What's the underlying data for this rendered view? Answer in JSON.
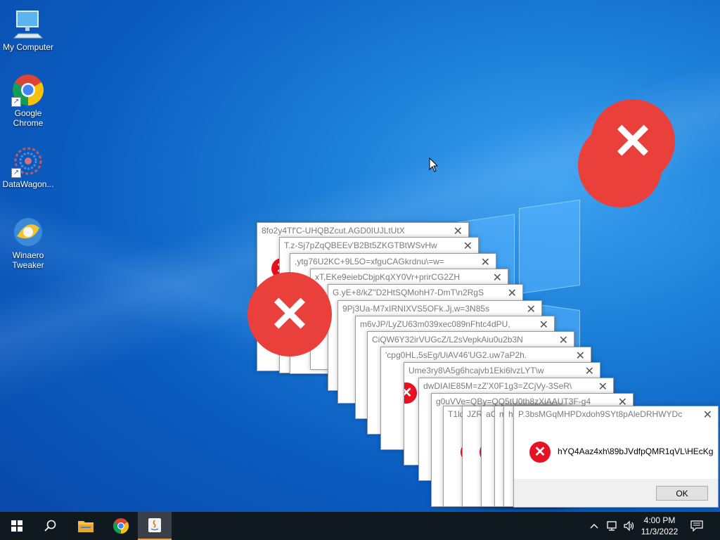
{
  "desktop": {
    "icons": [
      {
        "label": "My Computer",
        "icon": "computer-icon"
      },
      {
        "label": "Google Chrome",
        "icon": "chrome-icon"
      },
      {
        "label": "DataWagon...",
        "icon": "datawagon-icon"
      },
      {
        "label": "Winaero Tweaker",
        "icon": "winaero-icon"
      }
    ]
  },
  "dialogs": {
    "titles": [
      "8fo2y4Tf'C-UHQBZcut.AGD0IUJLtUtX",
      "T.z-Sj7pZqQBEEv'B2Bt5ZKGTBtWSvHw",
      ",ytg76U2KC+9L5O=xfguCAGkrdnu\\=w=",
      "xT,EKe9eiebCbjpKqXY0Vr+prirCG2ZH",
      "G.yE+8/kZ''D2HtSQMohH7-DmT\\n2RgS",
      "9Pj3Ua-M7xIRNIXVS5OFk.Jj,w=3N85s",
      "m6vJP/LyZU63m039xec089nFhtc4dPU,",
      "CiQW6Y32irVUGcZ/L2sVepkAiu0u2b3N",
      "'cpg0HL,5sEg/UiAV46'UG2.uw7aP2h.",
      "Ume3ry8\\A5g6hcajvb1Eki6lvzLYT\\w",
      "dwDIAIE85M=zZ'X0F1g3=ZCjVy-3SeR\\",
      "g0uVVe=QBy=QQ5tU0th8zXiAAUT3F-g4",
      "T1ld",
      "JZRN",
      "aC",
      "m",
      "h",
      "P.3bsMGqMHPDxdoh9SYt8pAleDRHWYDc"
    ],
    "front": {
      "message": "hYQ4Aaz4xh\\89bJVdfpQMR1qVL\\HEcKg",
      "ok_label": "OK"
    },
    "close_glyph": "✕",
    "error_glyph": "✕"
  },
  "taskbar": {
    "time": "4:00 PM",
    "date": "11/3/2022"
  },
  "colors": {
    "error_red": "#e81123",
    "big_error_red": "#e9403c",
    "taskbar": "#101820"
  }
}
